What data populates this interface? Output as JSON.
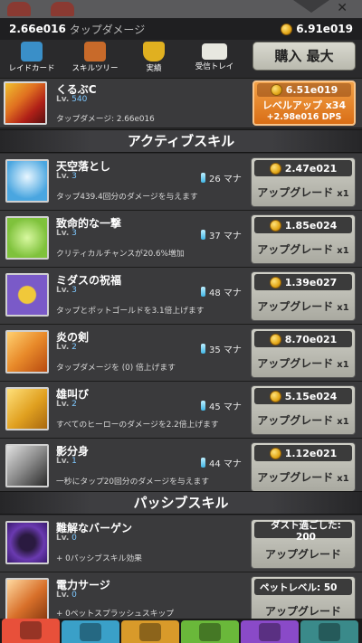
{
  "header": {
    "tap_damage_value": "2.66e016",
    "tap_damage_label": "タップダメージ",
    "gold": "6.91e019"
  },
  "menu": [
    {
      "label": "レイドカード",
      "icon": "raid-card-icon",
      "color": "#3a8fc8"
    },
    {
      "label": "スキルツリー",
      "icon": "skill-tree-icon",
      "color": "#c86a2a"
    },
    {
      "label": "実績",
      "icon": "trophy-icon",
      "color": "#e0b020"
    },
    {
      "label": "受信トレイ",
      "icon": "mail-icon",
      "color": "#e8e8e0"
    }
  ],
  "buy_button": "購入 最大",
  "hero": {
    "name": "くるぶC",
    "lv_label": "Lv.",
    "lv": "540",
    "desc": "タップダメージ: 2.66e016",
    "cost": "6.51e019",
    "levelup_label": "レベルアップ x34",
    "dps": "+2.98e016 DPS"
  },
  "sections": {
    "active": "アクティブスキル",
    "passive": "パッシブスキル"
  },
  "active_skills": [
    {
      "name": "天空落とし",
      "lv": "3",
      "mana": "26 マナ",
      "desc": "タップ439.4回分のダメージを与えます",
      "cost": "2.47e021",
      "btn": "アップグレード",
      "mult": "x1",
      "icon": "sky-strike-icon",
      "icon_bg": "#4aa6e0"
    },
    {
      "name": "致命的な一撃",
      "lv": "3",
      "mana": "37 マナ",
      "desc": "クリティカルチャンスが20.6%増加",
      "cost": "1.85e024",
      "btn": "アップグレード",
      "mult": "x1",
      "icon": "sword-icon",
      "icon_bg": "#7fc23c"
    },
    {
      "name": "ミダスの祝福",
      "lv": "3",
      "mana": "48 マナ",
      "desc": "タップとポットゴールドを3.1倍上げます",
      "cost": "1.39e027",
      "btn": "アップグレード",
      "mult": "x1",
      "icon": "crown-coin-icon",
      "icon_bg": "#7a5ac8"
    },
    {
      "name": "炎の剣",
      "lv": "2",
      "mana": "35 マナ",
      "desc": "タップダメージを (0) 倍上げます",
      "cost": "8.70e021",
      "btn": "アップグレード",
      "mult": "x1",
      "icon": "fire-sword-icon",
      "icon_bg": "#e88a2a"
    },
    {
      "name": "雄叫び",
      "lv": "2",
      "mana": "45 マナ",
      "desc": "すべてのヒーローのダメージを2.2倍上げます",
      "cost": "5.15e024",
      "btn": "アップグレード",
      "mult": "x1",
      "icon": "war-cry-icon",
      "icon_bg": "#e0a020"
    },
    {
      "name": "影分身",
      "lv": "1",
      "mana": "44 マナ",
      "desc": "一秒にタップ20回分のダメージを与えます",
      "cost": "1.12e021",
      "btn": "アップグレード",
      "mult": "x1",
      "icon": "shadow-clone-icon",
      "icon_bg": "#8a8a8a"
    }
  ],
  "passive_skills": [
    {
      "name": "難解なバーゲン",
      "lv": "0",
      "desc": "+ 0パッシブスキル効果",
      "req": "ダスト過ごした: 200",
      "btn": "アップグレード",
      "icon": "arcane-card-icon",
      "icon_bg": "#6a3ab0"
    },
    {
      "name": "電力サージ",
      "lv": "0",
      "desc": "+ 0ペットスプラッシュスキップ",
      "req": "ペットレベル: 50",
      "btn": "アップグレード",
      "icon": "power-surge-icon",
      "icon_bg": "#d8702a"
    }
  ],
  "tabs": [
    {
      "icon": "sword-tab-icon",
      "color": "#e8503a"
    },
    {
      "icon": "hero-tab-icon",
      "color": "#3aa0c8"
    },
    {
      "icon": "equipment-tab-icon",
      "color": "#d89a2a"
    },
    {
      "icon": "pet-tab-icon",
      "color": "#6ab83a"
    },
    {
      "icon": "clan-tab-icon",
      "color": "#8a4ac8"
    },
    {
      "icon": "shop-tab-icon",
      "color": "#3a8a8a"
    }
  ]
}
